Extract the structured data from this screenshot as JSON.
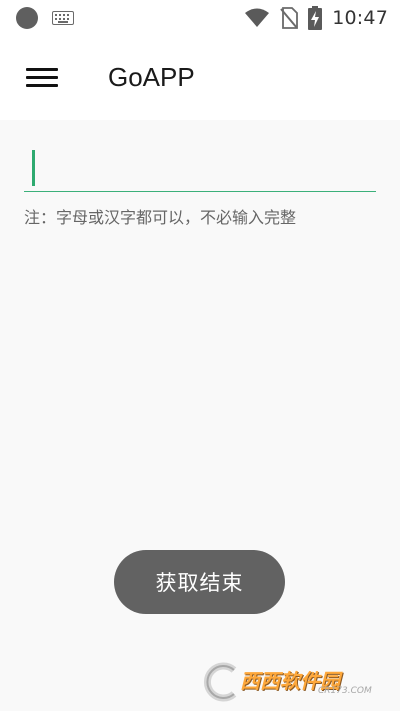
{
  "status_bar": {
    "time": "10:47",
    "icons": [
      "notification-dot-icon",
      "keyboard-icon",
      "wifi-icon",
      "no-sim-icon",
      "battery-charging-icon"
    ]
  },
  "app_bar": {
    "title": "GoAPP",
    "menu_icon": "hamburger-menu-icon"
  },
  "search": {
    "value": "",
    "placeholder": ""
  },
  "hint": {
    "text": "注：字母或汉字都可以，不必输入完整"
  },
  "toast": {
    "text": "获取结束"
  },
  "watermark": {
    "text": "西西软件园",
    "url": "CR173.COM"
  },
  "colors": {
    "accent": "#2eaa70",
    "toast_bg": "#626262",
    "background": "#f9f9f9"
  }
}
